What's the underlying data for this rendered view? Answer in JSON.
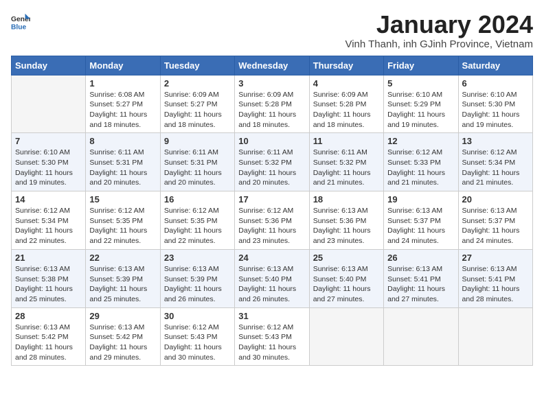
{
  "header": {
    "logo_general": "General",
    "logo_blue": "Blue",
    "month_title": "January 2024",
    "subtitle": "Vinh Thanh, inh GJinh Province, Vietnam"
  },
  "weekdays": [
    "Sunday",
    "Monday",
    "Tuesday",
    "Wednesday",
    "Thursday",
    "Friday",
    "Saturday"
  ],
  "weeks": [
    [
      {
        "day": "",
        "info": ""
      },
      {
        "day": "1",
        "info": "Sunrise: 6:08 AM\nSunset: 5:27 PM\nDaylight: 11 hours\nand 18 minutes."
      },
      {
        "day": "2",
        "info": "Sunrise: 6:09 AM\nSunset: 5:27 PM\nDaylight: 11 hours\nand 18 minutes."
      },
      {
        "day": "3",
        "info": "Sunrise: 6:09 AM\nSunset: 5:28 PM\nDaylight: 11 hours\nand 18 minutes."
      },
      {
        "day": "4",
        "info": "Sunrise: 6:09 AM\nSunset: 5:28 PM\nDaylight: 11 hours\nand 18 minutes."
      },
      {
        "day": "5",
        "info": "Sunrise: 6:10 AM\nSunset: 5:29 PM\nDaylight: 11 hours\nand 19 minutes."
      },
      {
        "day": "6",
        "info": "Sunrise: 6:10 AM\nSunset: 5:30 PM\nDaylight: 11 hours\nand 19 minutes."
      }
    ],
    [
      {
        "day": "7",
        "info": "Sunrise: 6:10 AM\nSunset: 5:30 PM\nDaylight: 11 hours\nand 19 minutes."
      },
      {
        "day": "8",
        "info": "Sunrise: 6:11 AM\nSunset: 5:31 PM\nDaylight: 11 hours\nand 20 minutes."
      },
      {
        "day": "9",
        "info": "Sunrise: 6:11 AM\nSunset: 5:31 PM\nDaylight: 11 hours\nand 20 minutes."
      },
      {
        "day": "10",
        "info": "Sunrise: 6:11 AM\nSunset: 5:32 PM\nDaylight: 11 hours\nand 20 minutes."
      },
      {
        "day": "11",
        "info": "Sunrise: 6:11 AM\nSunset: 5:32 PM\nDaylight: 11 hours\nand 21 minutes."
      },
      {
        "day": "12",
        "info": "Sunrise: 6:12 AM\nSunset: 5:33 PM\nDaylight: 11 hours\nand 21 minutes."
      },
      {
        "day": "13",
        "info": "Sunrise: 6:12 AM\nSunset: 5:34 PM\nDaylight: 11 hours\nand 21 minutes."
      }
    ],
    [
      {
        "day": "14",
        "info": "Sunrise: 6:12 AM\nSunset: 5:34 PM\nDaylight: 11 hours\nand 22 minutes."
      },
      {
        "day": "15",
        "info": "Sunrise: 6:12 AM\nSunset: 5:35 PM\nDaylight: 11 hours\nand 22 minutes."
      },
      {
        "day": "16",
        "info": "Sunrise: 6:12 AM\nSunset: 5:35 PM\nDaylight: 11 hours\nand 22 minutes."
      },
      {
        "day": "17",
        "info": "Sunrise: 6:12 AM\nSunset: 5:36 PM\nDaylight: 11 hours\nand 23 minutes."
      },
      {
        "day": "18",
        "info": "Sunrise: 6:13 AM\nSunset: 5:36 PM\nDaylight: 11 hours\nand 23 minutes."
      },
      {
        "day": "19",
        "info": "Sunrise: 6:13 AM\nSunset: 5:37 PM\nDaylight: 11 hours\nand 24 minutes."
      },
      {
        "day": "20",
        "info": "Sunrise: 6:13 AM\nSunset: 5:37 PM\nDaylight: 11 hours\nand 24 minutes."
      }
    ],
    [
      {
        "day": "21",
        "info": "Sunrise: 6:13 AM\nSunset: 5:38 PM\nDaylight: 11 hours\nand 25 minutes."
      },
      {
        "day": "22",
        "info": "Sunrise: 6:13 AM\nSunset: 5:39 PM\nDaylight: 11 hours\nand 25 minutes."
      },
      {
        "day": "23",
        "info": "Sunrise: 6:13 AM\nSunset: 5:39 PM\nDaylight: 11 hours\nand 26 minutes."
      },
      {
        "day": "24",
        "info": "Sunrise: 6:13 AM\nSunset: 5:40 PM\nDaylight: 11 hours\nand 26 minutes."
      },
      {
        "day": "25",
        "info": "Sunrise: 6:13 AM\nSunset: 5:40 PM\nDaylight: 11 hours\nand 27 minutes."
      },
      {
        "day": "26",
        "info": "Sunrise: 6:13 AM\nSunset: 5:41 PM\nDaylight: 11 hours\nand 27 minutes."
      },
      {
        "day": "27",
        "info": "Sunrise: 6:13 AM\nSunset: 5:41 PM\nDaylight: 11 hours\nand 28 minutes."
      }
    ],
    [
      {
        "day": "28",
        "info": "Sunrise: 6:13 AM\nSunset: 5:42 PM\nDaylight: 11 hours\nand 28 minutes."
      },
      {
        "day": "29",
        "info": "Sunrise: 6:13 AM\nSunset: 5:42 PM\nDaylight: 11 hours\nand 29 minutes."
      },
      {
        "day": "30",
        "info": "Sunrise: 6:12 AM\nSunset: 5:43 PM\nDaylight: 11 hours\nand 30 minutes."
      },
      {
        "day": "31",
        "info": "Sunrise: 6:12 AM\nSunset: 5:43 PM\nDaylight: 11 hours\nand 30 minutes."
      },
      {
        "day": "",
        "info": ""
      },
      {
        "day": "",
        "info": ""
      },
      {
        "day": "",
        "info": ""
      }
    ]
  ]
}
